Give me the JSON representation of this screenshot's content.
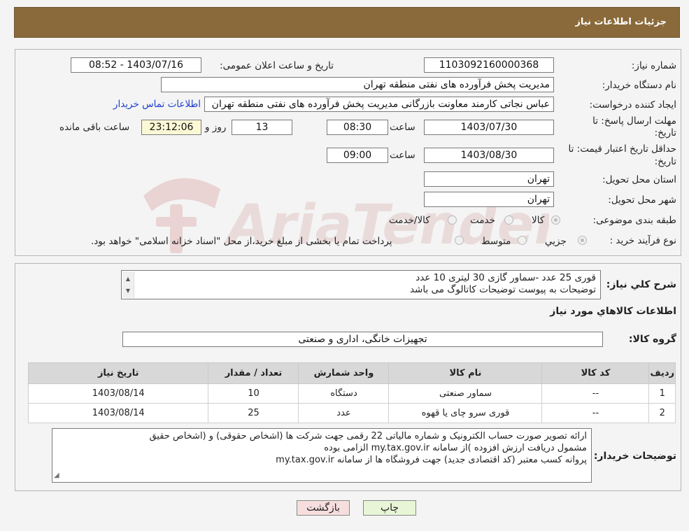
{
  "header": {
    "title": "جزئیات اطلاعات نیاز"
  },
  "form": {
    "need_number_label": "شماره نیاز:",
    "need_number": "1103092160000368",
    "announce_label": "تاریخ و ساعت اعلان عمومی:",
    "announce_value": "1403/07/16 - 08:52",
    "buyer_org_label": "نام دستگاه خریدار:",
    "buyer_org": "مدیریت پخش فرآورده های نفتی منطقه تهران",
    "creator_label": "ایجاد کننده درخواست:",
    "creator": "عباس نجاتی کارمند معاونت بازرگانی مدیریت پخش فرآورده های نفتی منطقه تهران",
    "contact_link": "اطلاعات تماس خریدار",
    "deadline_label_1": "مهلت ارسال پاسخ: تا",
    "deadline_label_2": "تاریخ:",
    "deadline_date": "1403/07/30",
    "time_label": "ساعت",
    "deadline_time": "08:30",
    "days_value": "13",
    "days_label": "روز و",
    "remaining_time": "23:12:06",
    "remaining_label": "ساعت باقی مانده",
    "validity_label_1": "حداقل تاریخ اعتبار قیمت: تا",
    "validity_label_2": "تاریخ:",
    "validity_date": "1403/08/30",
    "validity_time": "09:00",
    "province_label": "استان محل تحویل:",
    "province": "تهران",
    "city_label": "شهر محل تحویل:",
    "city": "تهران",
    "category_label": "طبقه بندی موضوعی:",
    "category_options": [
      "کالا",
      "خدمت",
      "کالا/خدمت"
    ],
    "process_label": "نوع فرآیند خرید :",
    "process_options": [
      "جزیي",
      "متوسط"
    ],
    "process_note": "پرداخت تمام یا بخشی از مبلغ خرید،از محل \"اسناد خزانه اسلامی\" خواهد بود."
  },
  "details": {
    "summary_label": "شرح کلي نیاز:",
    "summary_line1": "قوری 25 عدد -سماور گازی 30 لیتری 10 عدد",
    "summary_line2": "توضیحات به پیوست توضیحات کاتالوگ می باشد",
    "goods_info_title": "اطلاعات کالاهاي مورد نیاز",
    "goods_group_label": "گروه کالا:",
    "goods_group": "تجهیزات خانگی، اداری و صنعتی"
  },
  "table": {
    "headers": [
      "ردیف",
      "کد کالا",
      "نام کالا",
      "واحد شمارش",
      "تعداد / مقدار",
      "تاریخ نیاز"
    ],
    "rows": [
      [
        "1",
        "--",
        "سماور صنعتی",
        "دستگاه",
        "10",
        "1403/08/14"
      ],
      [
        "2",
        "--",
        "قوری سرو چای یا قهوه",
        "عدد",
        "25",
        "1403/08/14"
      ]
    ]
  },
  "notes": {
    "label": "توضیحات خریدار:",
    "line1": "ارائه  تصویر صورت حساب الکترونیک و شماره مالیاتی 22 رقمی  جهت شرکت ها (اشخاص حقوقی) و (اشخاص حقیق",
    "line2": "مشمول دریافت ارزش افزوده )از سامانه my.tax.gov.ir  الزامی بوده",
    "line3": "پروانه کسب معتبر (کد اقتصادی جدید) جهت فروشگاه ها از سامانه my.tax.gov.ir"
  },
  "buttons": {
    "back": "بازگشت",
    "print": "چاپ"
  },
  "watermark": {
    "text": "AriaTender.neT"
  },
  "colors": {
    "header_bg": "#8a6a3a",
    "back_button_bg": "#f7dede",
    "print_button_bg": "#e8f5d6",
    "link": "#1f3fd0"
  }
}
